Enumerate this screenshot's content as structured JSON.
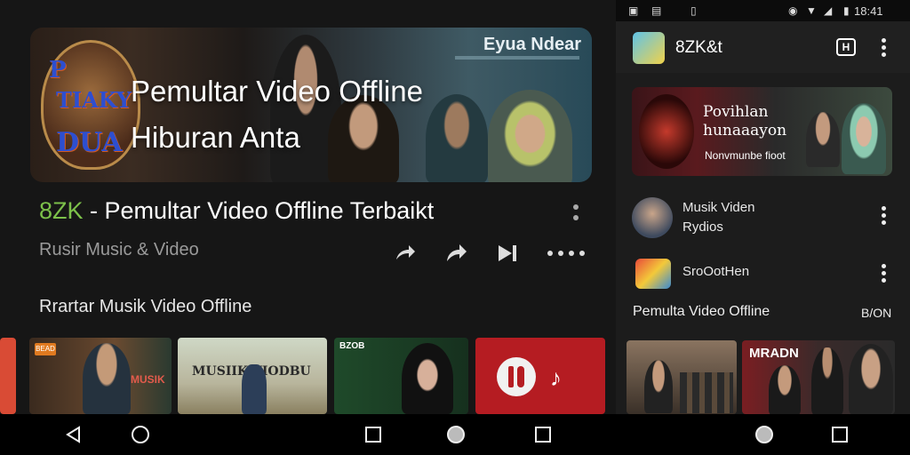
{
  "status_bar": {
    "time": "18:41"
  },
  "hero": {
    "line1": "Pemultar Video Offline",
    "line2": "Hiburan Anta",
    "brand": "Eyua Ndear",
    "poster_text": [
      "P",
      "TIAKY",
      "DUA"
    ]
  },
  "video": {
    "title_prefix": "8ZK",
    "title_rest": " - Pemultar Video Offline Terbaikt",
    "channel": "Rusir Music & Video",
    "section_title": "Rrartar Musik Video Offline"
  },
  "thumbnails": [
    {
      "caption": "MUSIK",
      "badge": "BEAD"
    },
    {
      "caption": "MUSIIK VIODBU"
    },
    {
      "caption": "BZOB"
    },
    {
      "caption": ""
    }
  ],
  "right_panel": {
    "app_name": "8ZK&t",
    "cast_label": "H",
    "banner": {
      "line1": "Povihlan",
      "line2": "hunaaayon",
      "sub": "Nonvmunbe fioot"
    },
    "items": [
      {
        "line1": "Musik Viden",
        "line2": "Rydios"
      },
      {
        "line1": "SroOotHen",
        "line2": ""
      }
    ],
    "section_title": "Pemulta Video Offline",
    "section_count": "B/ON",
    "thumb_caption": "MRADN"
  },
  "icons": {
    "back": "triangle-back-icon",
    "home": "circle-home-icon",
    "recents": "square-recents-icon"
  },
  "colors": {
    "accent_green": "#7cc04a",
    "background": "#161616"
  }
}
